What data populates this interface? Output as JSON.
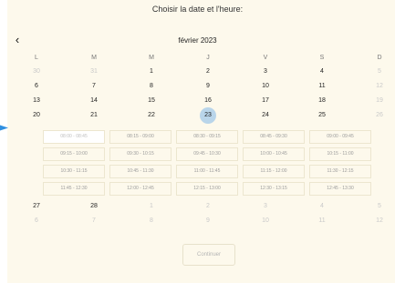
{
  "header": {
    "title": "Choisir la date et l'heure:",
    "month": "février 2023",
    "prev_icon": "chevron-left-icon"
  },
  "weekdays": [
    "L",
    "M",
    "M",
    "J",
    "V",
    "S",
    "D"
  ],
  "weeks": [
    [
      {
        "d": "30",
        "dim": true
      },
      {
        "d": "31",
        "dim": true
      },
      {
        "d": "1"
      },
      {
        "d": "2"
      },
      {
        "d": "3"
      },
      {
        "d": "4"
      },
      {
        "d": "5",
        "dim": true
      }
    ],
    [
      {
        "d": "6"
      },
      {
        "d": "7"
      },
      {
        "d": "8"
      },
      {
        "d": "9"
      },
      {
        "d": "10"
      },
      {
        "d": "11"
      },
      {
        "d": "12",
        "dim": true
      }
    ],
    [
      {
        "d": "13"
      },
      {
        "d": "14"
      },
      {
        "d": "15"
      },
      {
        "d": "16"
      },
      {
        "d": "17"
      },
      {
        "d": "18"
      },
      {
        "d": "19",
        "dim": true
      }
    ],
    [
      {
        "d": "20"
      },
      {
        "d": "21"
      },
      {
        "d": "22"
      },
      {
        "d": "23",
        "selected": true
      },
      {
        "d": "24"
      },
      {
        "d": "25"
      },
      {
        "d": "26",
        "dim": true
      }
    ],
    [
      {
        "d": "27"
      },
      {
        "d": "28"
      },
      {
        "d": "1",
        "dim": true
      },
      {
        "d": "2",
        "dim": true
      },
      {
        "d": "3",
        "dim": true
      },
      {
        "d": "4",
        "dim": true
      },
      {
        "d": "5",
        "dim": true
      }
    ],
    [
      {
        "d": "6",
        "dim": true
      },
      {
        "d": "7",
        "dim": true
      },
      {
        "d": "8",
        "dim": true
      },
      {
        "d": "9",
        "dim": true
      },
      {
        "d": "10",
        "dim": true
      },
      {
        "d": "11",
        "dim": true
      },
      {
        "d": "12",
        "dim": true
      }
    ]
  ],
  "time_slots": [
    "08:00 - 08:45",
    "08:15 - 09:00",
    "08:30 - 09:15",
    "08:45 - 09:30",
    "09:00 - 09:45",
    "09:15 - 10:00",
    "09:30 - 10:15",
    "09:45 - 10:30",
    "10:00 - 10:45",
    "10:15 - 11:00",
    "10:30 - 11:15",
    "10:45 - 11:30",
    "11:00 - 11:45",
    "11:15 - 12:00",
    "11:30 - 12:15",
    "11:45 - 12:30",
    "12:00 - 12:45",
    "12:15 - 13:00",
    "12:30 - 13:15",
    "12:45 - 13:30"
  ],
  "continue_label": "Continuer",
  "colors": {
    "panel": "#fdf9ec",
    "selected_day": "#b9d5ea",
    "arrow": "#2f8fe0"
  }
}
